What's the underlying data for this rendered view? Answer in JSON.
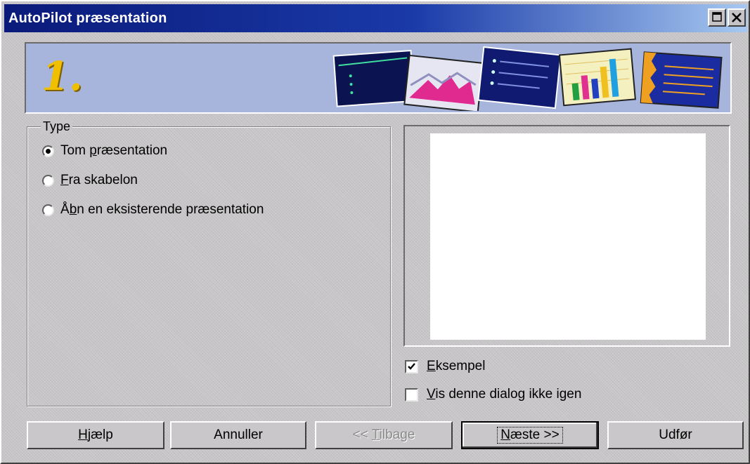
{
  "window": {
    "title": "AutoPilot præsentation",
    "maximize_icon": "maximize-icon",
    "close_icon": "close-icon"
  },
  "banner": {
    "step": "1."
  },
  "type_group": {
    "legend": "Type",
    "options": [
      {
        "pre": "Tom ",
        "accel": "p",
        "post": "ræsentation",
        "checked": true
      },
      {
        "pre": "",
        "accel": "F",
        "post": "ra skabelon",
        "checked": false
      },
      {
        "pre": "Å",
        "accel": "b",
        "post": "n en eksisterende præsentation",
        "checked": false
      }
    ]
  },
  "preview": {
    "checkboxes": [
      {
        "accel": "E",
        "post": "ksempel",
        "checked": true
      },
      {
        "accel": "V",
        "post": "is denne dialog ikke igen",
        "checked": false
      }
    ]
  },
  "buttons": {
    "help": {
      "accel": "H",
      "post": "jælp"
    },
    "cancel": {
      "label": "Annuller"
    },
    "back": {
      "pre": "<< ",
      "accel": "T",
      "post": "ilbage"
    },
    "next": {
      "accel": "N",
      "post": "æste >>"
    },
    "finish": {
      "label": "Udfør"
    }
  },
  "colors": {
    "titlebar_start": "#0a1a7a",
    "banner_bg": "#a7b5dd",
    "step_number": "#f0c000"
  }
}
